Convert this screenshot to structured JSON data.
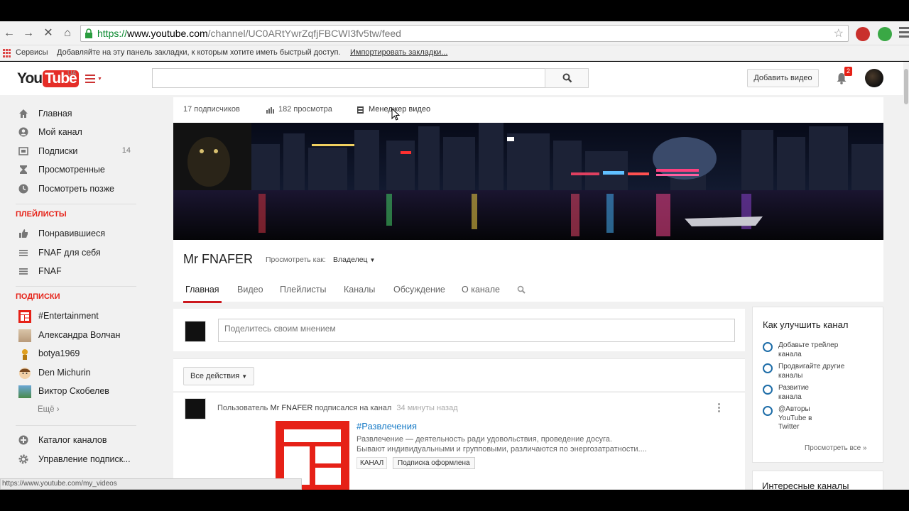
{
  "browser": {
    "url_scheme": "https://",
    "url_host": "www.youtube.com",
    "url_path": "/channel/UC0ARtYwrZqfjFBCWI3fv5tw/feed",
    "bookmarks": {
      "apps_label": "Сервисы",
      "hint": "Добавляйте на эту панель закладки, к которым хотите иметь быстрый доступ.",
      "import_link": "Импортировать закладки..."
    },
    "status_url": "https://www.youtube.com/my_videos"
  },
  "masthead": {
    "logo_you": "You",
    "logo_tube": "Tube",
    "region": "UA",
    "upload_label": "Добавить видео",
    "notifications_count": "2"
  },
  "sidebar": {
    "main": [
      {
        "label": "Главная",
        "icon": "home-icon"
      },
      {
        "label": "Мой канал",
        "icon": "user-icon"
      },
      {
        "label": "Подписки",
        "icon": "subscriptions-icon",
        "count": "14"
      },
      {
        "label": "Просмотренные",
        "icon": "history-icon"
      },
      {
        "label": "Посмотреть позже",
        "icon": "clock-icon"
      }
    ],
    "playlists_header": "ПЛЕЙЛИСТЫ",
    "playlists": [
      {
        "label": "Понравившиеся",
        "icon": "thumbs-up-icon"
      },
      {
        "label": "FNAF для себя",
        "icon": "list-icon"
      },
      {
        "label": "FNAF",
        "icon": "list-icon"
      }
    ],
    "subscriptions_header": "ПОДПИСКИ",
    "subscriptions": [
      {
        "label": "#Entertainment"
      },
      {
        "label": "Александра Волчан"
      },
      {
        "label": "botya1969"
      },
      {
        "label": "Den Michurin"
      },
      {
        "label": "Виктор Скобелев"
      }
    ],
    "more": "Ещё ›",
    "bottom": [
      {
        "label": "Каталог каналов",
        "icon": "plus-circle-icon"
      },
      {
        "label": "Управление подписк...",
        "icon": "gear-icon"
      }
    ]
  },
  "channel": {
    "subscribers": "17 подписчиков",
    "views": "182 просмотра",
    "video_manager": "Менеджер видео",
    "title": "Mr FNAFER",
    "view_as_label": "Просмотреть как:",
    "view_as_value": "Владелец",
    "tabs": [
      "Главная",
      "Видео",
      "Плейлисты",
      "Каналы",
      "Обсуждение",
      "О канале"
    ]
  },
  "feed": {
    "share_placeholder": "Поделитесь своим мнением",
    "filter_label": "Все действия",
    "item": {
      "prefix": "Пользователь",
      "user": "Mr FNAFER",
      "action": "подписался на канал",
      "time": "34 минуты назад",
      "channel_title": "#Развлечения",
      "desc_line1": "Развлечение — деятельность ради удовольствия, проведение досуга.",
      "desc_line2": "Бывают индивидуальными и групповыми, различаются по энергозатратности....",
      "tag": "КАНАЛ",
      "subscribed": "Подписка оформлена"
    }
  },
  "improve": {
    "title": "Как улучшить канал",
    "items": [
      "Добавьте трейлер канала",
      "Продвигайте другие каналы",
      "Развитие канала",
      "@Авторы YouTube в Twitter"
    ],
    "view_all": "Просмотреть все  »"
  },
  "interesting": {
    "title": "Интересные каналы"
  },
  "colors": {
    "accent_red": "#e62117",
    "link_blue": "#167ac6",
    "ring_blue": "#1e6da8"
  }
}
